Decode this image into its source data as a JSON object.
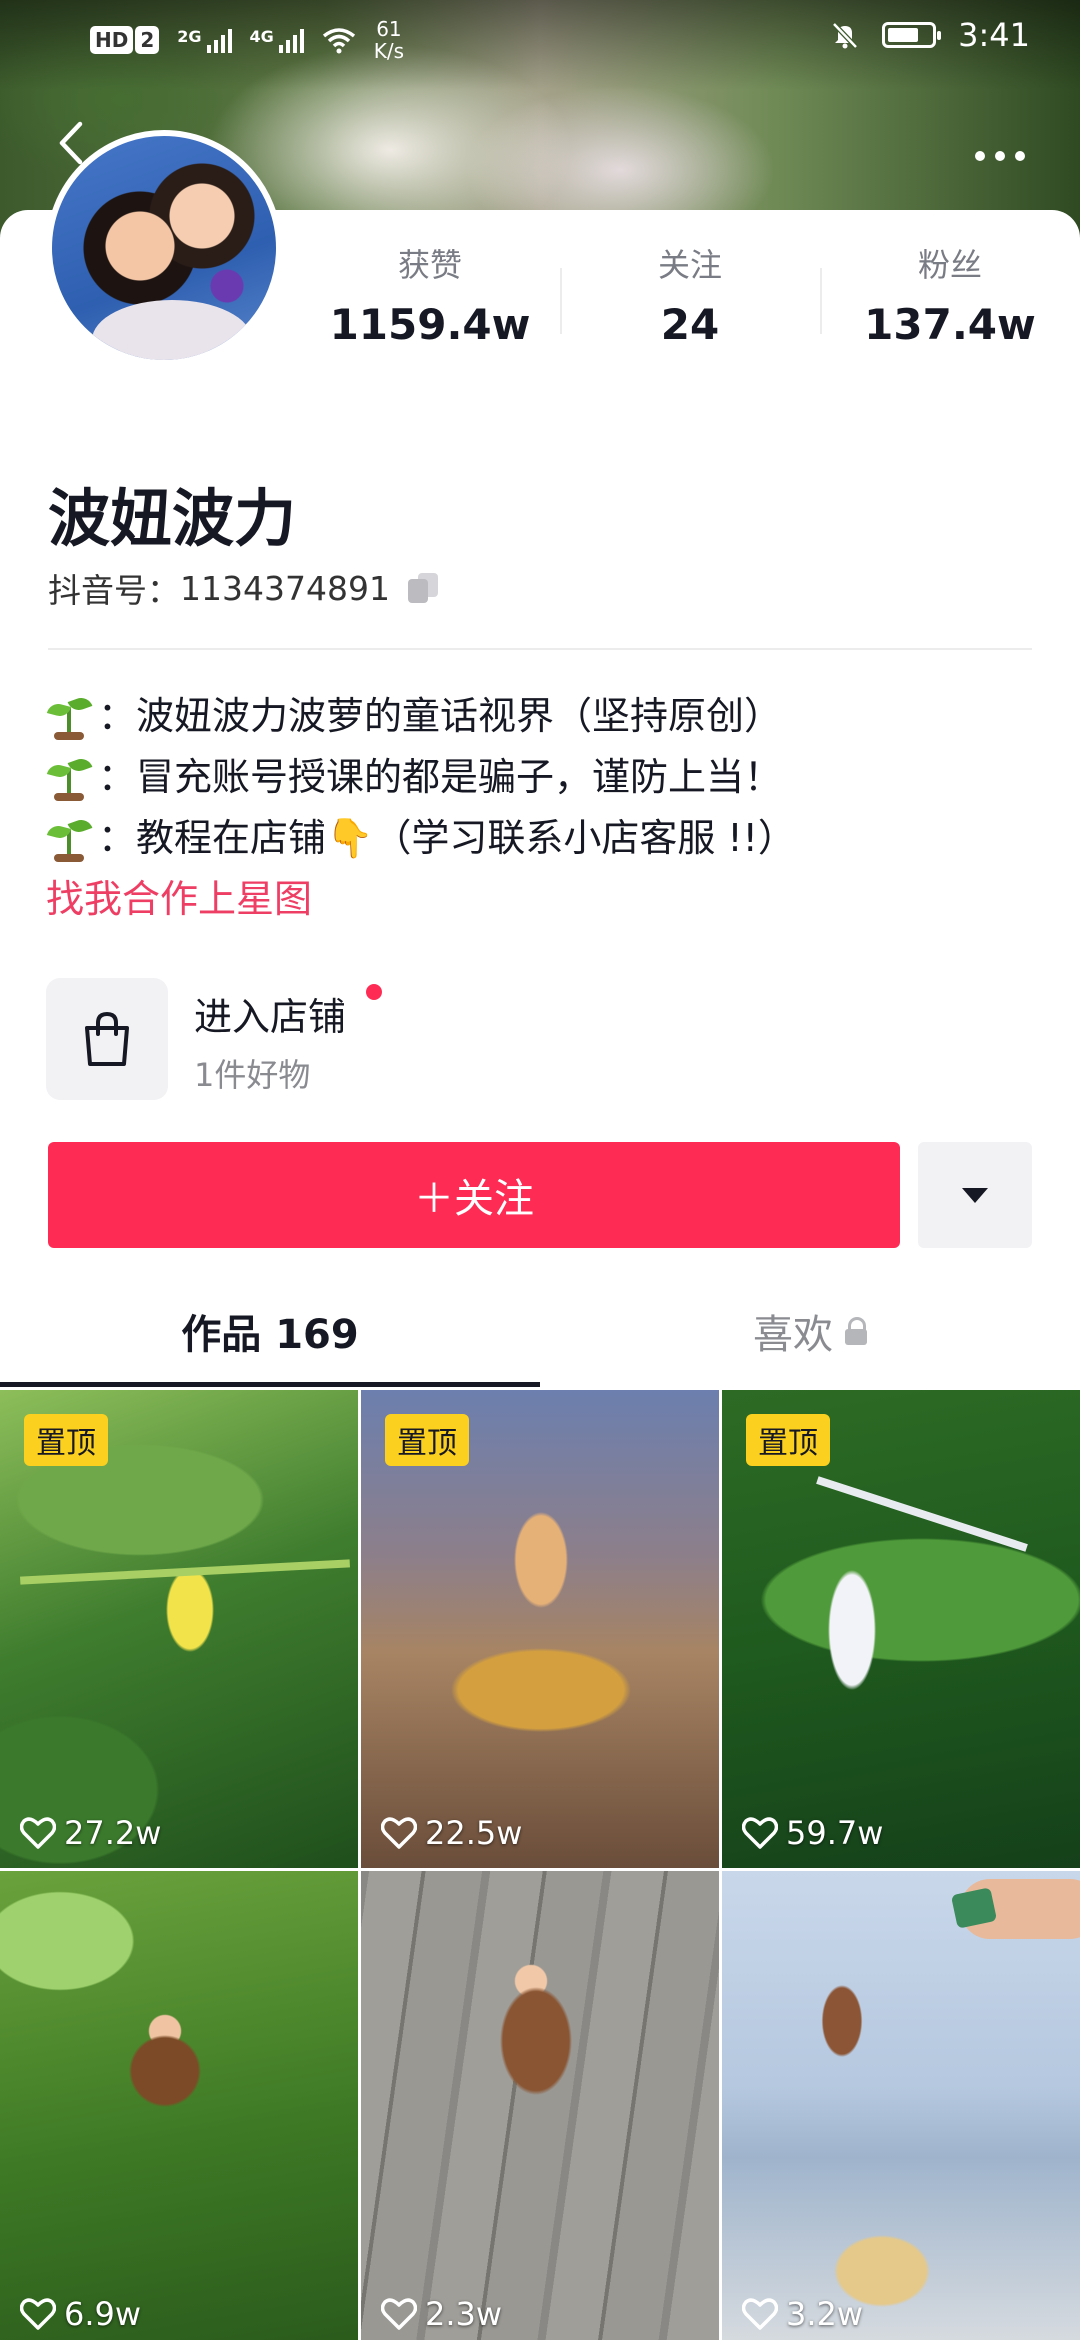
{
  "status_bar": {
    "hd_label": "HD",
    "sim2_label": "2",
    "network_1": "2G",
    "network_2": "4G",
    "speed_value": "61",
    "speed_unit": "K/s",
    "battery_level_percent": 70,
    "time": "3:41"
  },
  "profile": {
    "stats": [
      {
        "label": "获赞",
        "value": "1159.4w"
      },
      {
        "label": "关注",
        "value": "24"
      },
      {
        "label": "粉丝",
        "value": "137.4w"
      }
    ],
    "nickname": "波妞波力",
    "douyin_id_label": "抖音号：",
    "douyin_id": "1134374891",
    "bio": [
      "：波妞波力波萝的童话视界（坚持原创）",
      "：冒充账号授课的都是骗子，谨防上当！",
      "：教程在店铺👇（学习联系小店客服 !!）"
    ],
    "bio_link": "找我合作上星图"
  },
  "shop": {
    "title": "进入店铺",
    "subtitle": "1件好物"
  },
  "actions": {
    "follow_label": "＋关注"
  },
  "tabs": {
    "works_label": "作品 169",
    "likes_label": "喜欢"
  },
  "videos": [
    {
      "pinned_label": "置顶",
      "likes": "27.2w"
    },
    {
      "pinned_label": "置顶",
      "likes": "22.5w"
    },
    {
      "pinned_label": "置顶",
      "likes": "59.7w"
    },
    {
      "likes": "6.9w"
    },
    {
      "likes": "2.3w"
    },
    {
      "likes": "3.2w"
    }
  ],
  "colors": {
    "accent": "#fe2c55",
    "bio_link": "#ee3e64",
    "pin_badge": "#fcd01f",
    "text_primary": "#161823",
    "text_secondary": "#8a8b91"
  }
}
